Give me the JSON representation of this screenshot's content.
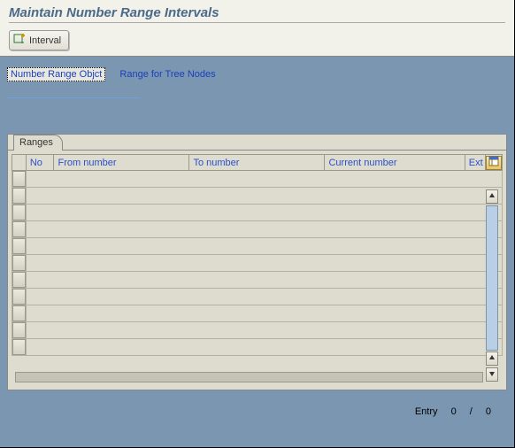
{
  "header": {
    "title": "Maintain Number Range Intervals",
    "interval_button": "Interval"
  },
  "fields": {
    "object_label": "Number Range Objct",
    "tree_label": "Range for Tree Nodes"
  },
  "panel": {
    "tab_label": "Ranges",
    "columns": {
      "no": "No",
      "from": "From number",
      "to": "To number",
      "current": "Current number",
      "ext": "Ext"
    }
  },
  "footer": {
    "entry_label": "Entry",
    "current": "0",
    "sep": "/",
    "total": "0"
  }
}
